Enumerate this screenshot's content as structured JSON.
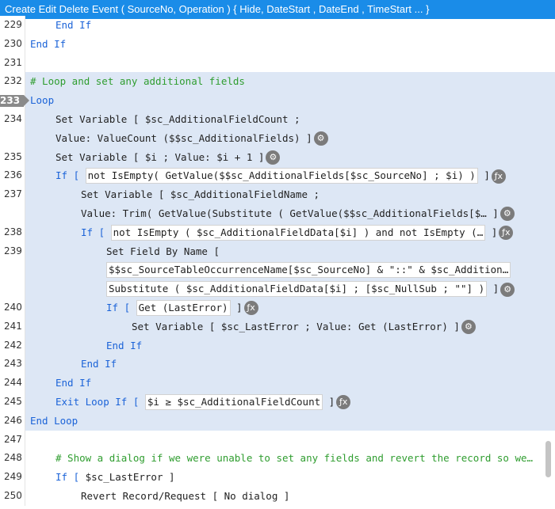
{
  "title": "Create Edit Delete Event ( SourceNo, Operation ) { Hide, DateStart , DateEnd , TimeStart ... }",
  "lines": [
    {
      "n": "229",
      "indent": 70,
      "sel": false,
      "parts": [
        {
          "t": "End If",
          "c": "kw"
        }
      ]
    },
    {
      "n": "230",
      "indent": 38,
      "sel": false,
      "parts": [
        {
          "t": "End If",
          "c": "kw"
        }
      ]
    },
    {
      "n": "231",
      "indent": 38,
      "sel": false,
      "parts": []
    },
    {
      "n": "232",
      "indent": 38,
      "sel": true,
      "parts": [
        {
          "t": "# Loop and set any additional fields",
          "c": "cm"
        }
      ]
    },
    {
      "n": "233",
      "indent": 38,
      "sel": true,
      "cur": true,
      "parts": [
        {
          "t": "Loop",
          "c": "kw"
        }
      ]
    },
    {
      "n": "234",
      "indent": 70,
      "sel": true,
      "parts": [
        {
          "t": "Set Variable [ $sc_AdditionalFieldCount ;",
          "c": ""
        }
      ]
    },
    {
      "n": "",
      "indent": 70,
      "sel": true,
      "parts": [
        {
          "t": "Value: ValueCount ($$sc_AdditionalFields) ]",
          "c": ""
        },
        {
          "icon": "gear-icon"
        }
      ]
    },
    {
      "n": "235",
      "indent": 70,
      "sel": true,
      "parts": [
        {
          "t": "Set Variable [ $i ; Value: $i + 1 ]",
          "c": ""
        },
        {
          "icon": "gear-icon"
        }
      ]
    },
    {
      "n": "236",
      "indent": 70,
      "sel": true,
      "parts": [
        {
          "t": "If [ ",
          "c": "kw"
        },
        {
          "t": "not IsEmpty( GetValue($$sc_AdditionalFields[$sc_SourceNo] ; $i) )",
          "c": "box"
        },
        {
          "t": " ]",
          "c": ""
        },
        {
          "icon": "function-icon"
        }
      ]
    },
    {
      "n": "237",
      "indent": 102,
      "sel": true,
      "parts": [
        {
          "t": "Set Variable [ $sc_AdditionalFieldName ;",
          "c": ""
        }
      ]
    },
    {
      "n": "",
      "indent": 102,
      "sel": true,
      "parts": [
        {
          "t": "Value: Trim( GetValue(Substitute ( GetValue($$sc_AdditionalFields[$… ]",
          "c": ""
        },
        {
          "icon": "gear-icon"
        }
      ]
    },
    {
      "n": "238",
      "indent": 102,
      "sel": true,
      "parts": [
        {
          "t": "If [ ",
          "c": "kw"
        },
        {
          "t": "not IsEmpty ( $sc_AdditionalFieldData[$i] ) and not IsEmpty (…",
          "c": "box"
        },
        {
          "t": " ]",
          "c": ""
        },
        {
          "icon": "function-icon"
        }
      ]
    },
    {
      "n": "239",
      "indent": 134,
      "sel": true,
      "parts": [
        {
          "t": "Set Field By Name [",
          "c": ""
        }
      ]
    },
    {
      "n": "",
      "indent": 134,
      "sel": true,
      "parts": [
        {
          "t": "$$sc_SourceTableOccurrenceName[$sc_SourceNo] & \"::\" & $sc_Addition…",
          "c": "box"
        }
      ]
    },
    {
      "n": "",
      "indent": 134,
      "sel": true,
      "parts": [
        {
          "t": "Substitute ( $sc_AdditionalFieldData[$i] ; [$sc_NullSub ; \"\"] )",
          "c": "box"
        },
        {
          "t": " ]",
          "c": ""
        },
        {
          "icon": "gear-icon"
        }
      ]
    },
    {
      "n": "240",
      "indent": 134,
      "sel": true,
      "parts": [
        {
          "t": "If [ ",
          "c": "kw"
        },
        {
          "t": "Get (LastError)",
          "c": "box"
        },
        {
          "t": " ]",
          "c": ""
        },
        {
          "icon": "function-icon"
        }
      ]
    },
    {
      "n": "241",
      "indent": 166,
      "sel": true,
      "parts": [
        {
          "t": "Set Variable [ $sc_LastError ; Value: Get (LastError) ]",
          "c": ""
        },
        {
          "icon": "gear-icon"
        }
      ]
    },
    {
      "n": "242",
      "indent": 134,
      "sel": true,
      "parts": [
        {
          "t": "End If",
          "c": "kw"
        }
      ]
    },
    {
      "n": "243",
      "indent": 102,
      "sel": true,
      "parts": [
        {
          "t": "End If",
          "c": "kw"
        }
      ]
    },
    {
      "n": "244",
      "indent": 70,
      "sel": true,
      "parts": [
        {
          "t": "End If",
          "c": "kw"
        }
      ]
    },
    {
      "n": "245",
      "indent": 70,
      "sel": true,
      "parts": [
        {
          "t": "Exit Loop If [ ",
          "c": "kw"
        },
        {
          "t": "$i ≥ $sc_AdditionalFieldCount",
          "c": "box"
        },
        {
          "t": " ]",
          "c": ""
        },
        {
          "icon": "function-icon"
        }
      ]
    },
    {
      "n": "246",
      "indent": 38,
      "sel": true,
      "parts": [
        {
          "t": "End Loop",
          "c": "kw"
        }
      ]
    },
    {
      "n": "247",
      "indent": 38,
      "sel": false,
      "parts": []
    },
    {
      "n": "248",
      "indent": 70,
      "sel": false,
      "parts": [
        {
          "t": "# Show a dialog if we were unable to set any fields and revert the record so we…",
          "c": "cm"
        }
      ]
    },
    {
      "n": "249",
      "indent": 70,
      "sel": false,
      "parts": [
        {
          "t": "If [ ",
          "c": "kw"
        },
        {
          "t": "$sc_LastError",
          "c": ""
        },
        {
          "t": " ]",
          "c": ""
        }
      ]
    },
    {
      "n": "250",
      "indent": 102,
      "sel": false,
      "parts": [
        {
          "t": "Revert Record/Request [ No dialog ]",
          "c": ""
        }
      ]
    }
  ],
  "icons": {
    "gear-icon": "⚙",
    "function-icon": "ƒx"
  },
  "colors": {
    "title_bg": "#1a8ce8",
    "selection": "#dde7f5",
    "keyword": "#1b63d8",
    "comment": "#2f9d2f"
  }
}
